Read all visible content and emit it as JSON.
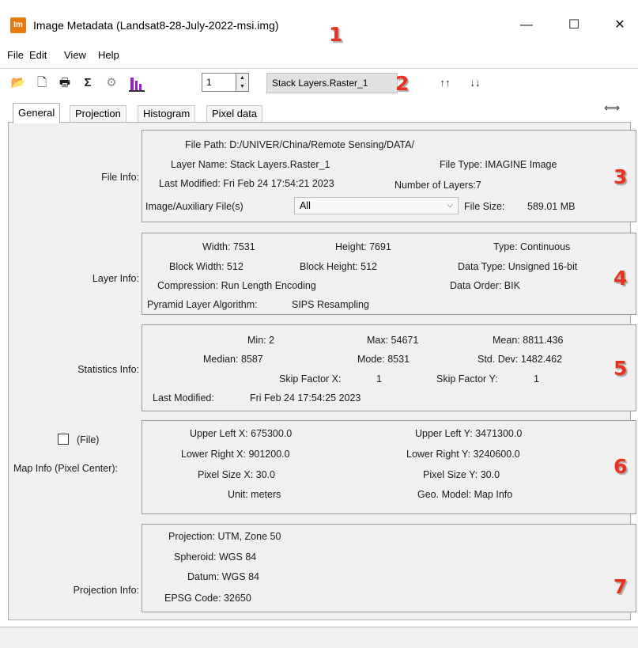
{
  "window": {
    "app_icon_text": "Im",
    "title": "Image Metadata (Landsat8-28-July-2022-msi.img)",
    "minimize_glyph": "—",
    "maximize_glyph": "☐",
    "close_glyph": "✕"
  },
  "menu": {
    "items": [
      "File",
      "Edit",
      "View",
      "Help"
    ]
  },
  "toolbar": {
    "icons": [
      "open-folder-icon",
      "new-document-icon",
      "print-icon",
      "sigma-icon",
      "gear-icon",
      "histogram-icon"
    ],
    "glyphs": {
      "open": "📂",
      "new": "🗋",
      "print": "🖶",
      "sigma": "Σ",
      "gear": "⚙",
      "histogram": "📊",
      "sort_up": "↑↑",
      "sort_down": "↓↓",
      "spin_up": "▲",
      "spin_down": "▼"
    },
    "layer_number": "1",
    "layer_name": "Stack Layers.Raster_1"
  },
  "tabs": [
    "General",
    "Projection",
    "Histogram",
    "Pixel data"
  ],
  "resize_glyph": "⟺",
  "file_info": {
    "label": "File Info:",
    "file_path": "File Path: D:/UNIVER/China/Remote Sensing/DATA/",
    "layer_name": "Layer Name: Stack Layers.Raster_1",
    "file_type": "File Type: IMAGINE Image",
    "last_modified": "Last Modified: Fri Feb 24 17:54:21 2023",
    "number_of_layers": "Number of Layers:7",
    "aux_label": "Image/Auxiliary File(s)",
    "aux_value": "All",
    "aux_chevron": "⌵",
    "file_size_label": "File Size:",
    "file_size_value": "589.01 MB"
  },
  "layer_info": {
    "label": "Layer Info:",
    "width": "Width: 7531",
    "height": "Height: 7691",
    "type": "Type: Continuous",
    "block_width": "Block Width: 512",
    "block_height": "Block Height:  512",
    "data_type": "Data Type: Unsigned 16-bit",
    "compression": "Compression: Run Length Encoding",
    "data_order": "Data Order: BIK",
    "pyramid_label": "Pyramid Layer Algorithm:",
    "pyramid_value": "SIPS Resampling"
  },
  "statistics_info": {
    "label": "Statistics Info:",
    "min": "Min: 2",
    "max": "Max: 54671",
    "mean": "Mean: 8811.436",
    "median": "Median: 8587",
    "mode": "Mode: 8531",
    "std_dev": "Std. Dev: 1482.462",
    "skip_x_label": "Skip Factor X:",
    "skip_x_value": "1",
    "skip_y_label": "Skip Factor Y:",
    "skip_y_value": "1",
    "last_modified_label": "Last Modified:",
    "last_modified_value": "Fri Feb 24 17:54:25 2023"
  },
  "map_info": {
    "checkbox_label": "(File)",
    "label": "Map Info (Pixel Center):",
    "upper_left_x": "Upper Left X: 675300.0",
    "upper_left_y": "Upper Left Y: 3471300.0",
    "lower_right_x": "Lower Right X: 901200.0",
    "lower_right_y": "Lower Right Y: 3240600.0",
    "pixel_size_x": "Pixel Size X: 30.0",
    "pixel_size_y": "Pixel Size Y: 30.0",
    "unit": "Unit: meters",
    "geo_model": "Geo. Model: Map Info"
  },
  "projection_info": {
    "label": "Projection Info:",
    "projection": "Projection: UTM, Zone 50",
    "spheroid": "Spheroid: WGS 84",
    "datum": "Datum: WGS 84",
    "epsg": "EPSG Code: 32650"
  },
  "annotations": [
    "1",
    "2",
    "3",
    "4",
    "5",
    "6",
    "7"
  ],
  "colors": {
    "app_icon": "#e8790f",
    "annotation": "#e8321e",
    "histogram_icon": "#9b1fd0"
  }
}
